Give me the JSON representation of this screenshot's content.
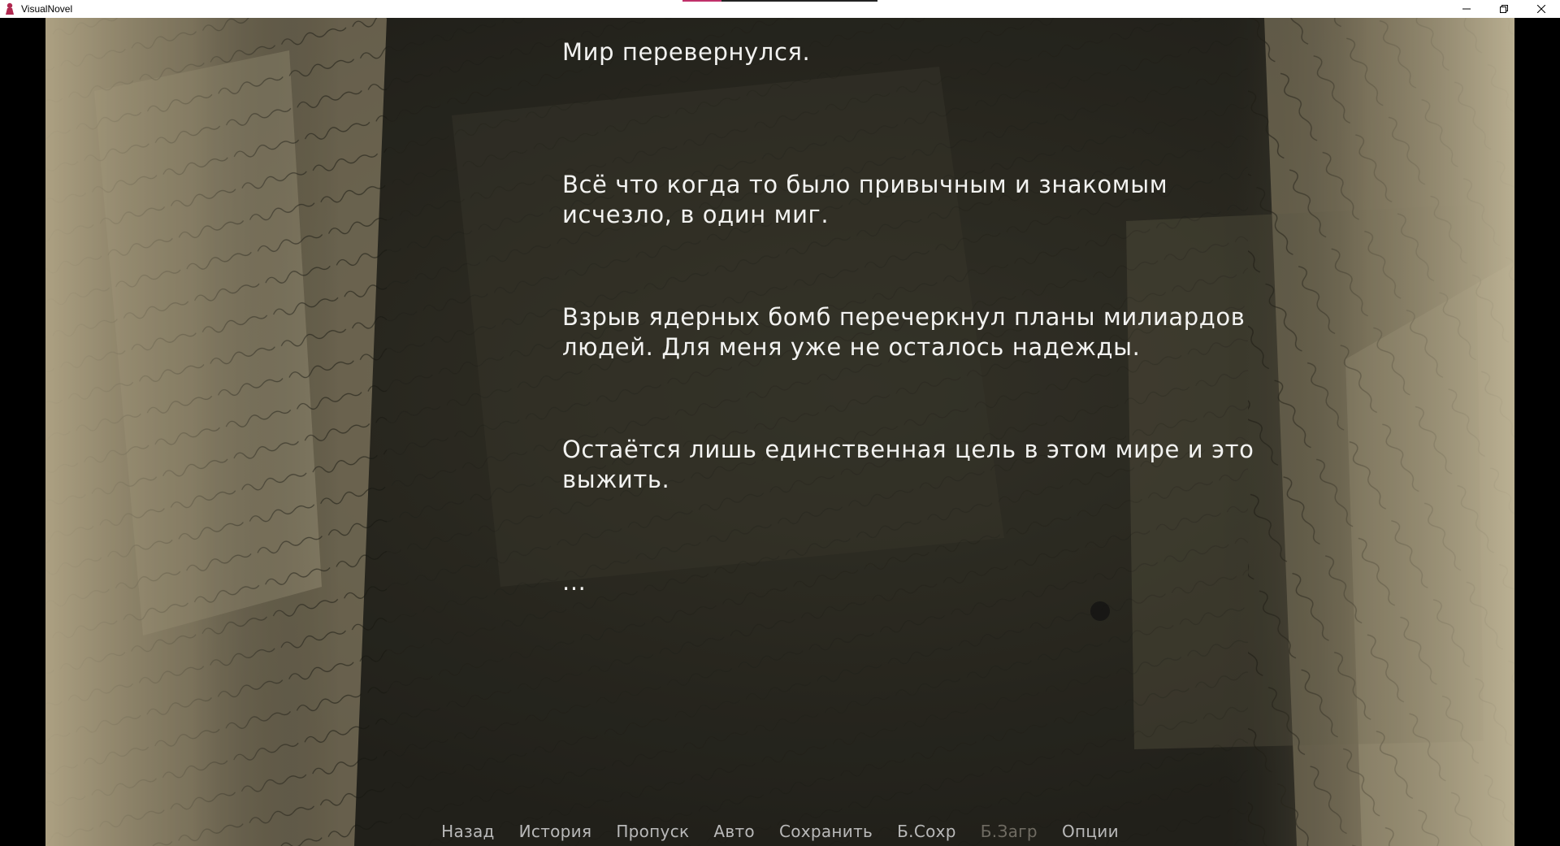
{
  "window": {
    "title": "VisualNovel",
    "controls": [
      "minimize-icon",
      "restore-icon",
      "close-icon"
    ],
    "accent_color": "#c0306a"
  },
  "narration": {
    "paragraphs": [
      "Мир перевернулся.",
      "Всё что когда то было привычным и знакомым исчезло, в один миг.",
      "Взрыв ядерных бомб перечеркнул планы милиардов людей. Для меня уже не осталось надежды.",
      "Остаётся лишь единственная цель в этом мире и это выжить.",
      "..."
    ],
    "text_color": "#f2f2f0"
  },
  "quick_menu": {
    "items": [
      {
        "label": "Назад",
        "enabled": true
      },
      {
        "label": "История",
        "enabled": true
      },
      {
        "label": "Пропуск",
        "enabled": true
      },
      {
        "label": "Авто",
        "enabled": true
      },
      {
        "label": "Сохранить",
        "enabled": true
      },
      {
        "label": "Б.Сохр",
        "enabled": true
      },
      {
        "label": "Б.Загр",
        "enabled": false
      },
      {
        "label": "Опции",
        "enabled": true
      }
    ],
    "color": "#b9b9b9",
    "disabled_color": "#6f6b62"
  },
  "background": {
    "description_icon": "old-handwritten-letters-background",
    "base_color": "#2b2a22",
    "paper_color": "#c9bb98"
  }
}
